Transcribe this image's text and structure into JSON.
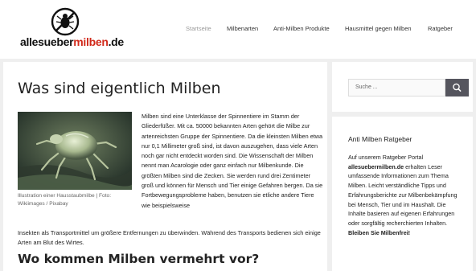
{
  "header": {
    "logo": {
      "part1": "alles",
      "part2": "ueber",
      "part3": "milben",
      "part4": ".de"
    },
    "nav": [
      {
        "label": "Startseite",
        "active": true
      },
      {
        "label": "Milbenarten",
        "active": false
      },
      {
        "label": "Anti-Milben Produkte",
        "active": false
      },
      {
        "label": "Hausmittel gegen Milben",
        "active": false
      },
      {
        "label": "Ratgeber",
        "active": false
      }
    ]
  },
  "article": {
    "title": "Was sind eigentlich Milben",
    "image_caption": "Illustration einer Hausstaubmilbe | Foto: Wikiimages / Pixabay",
    "paragraph_wrapped": "Milben sind eine Unterklasse der Spinnentiere im Stamm der Gliederfüßer. Mit ca. 50000 bekannten Arten gehört die Milbe zur artenreichsten Gruppe der Spinnentiere. Da die kleinsten Milben etwa nur 0,1 Millimeter groß sind, ist davon auszugehen, dass viele Arten noch gar nicht entdeckt worden sind. Die Wissenschaft der Milben nennt man Acarologie oder ganz einfach nur Milbenkunde. Die größten Milben sind die Zecken. Sie werden rund drei Zentimeter groß und können für Mensch und Tier einige Gefahren bergen. Da sie Fortbewegungsprobleme haben, benutzen sie etliche andere Tiere wie beispielsweise",
    "paragraph_full": "Insekten als Transportmittel um größere Entfernungen zu überwinden. Während des Transports bedienen sich einige Arten am Blut des Wirtes.",
    "subheading": "Wo kommen Milben vermehrt vor?"
  },
  "sidebar": {
    "search": {
      "placeholder": "Suche ..."
    },
    "ratgeber": {
      "title": "Anti Milben Ratgeber",
      "intro": "Auf unserem Ratgeber Portal ",
      "site": "allesuebermilben.de",
      "body": " erhalten Leser umfassende Informationen zum Thema Milben. Leicht verständliche Tipps und Erfahrungsberichte zur Milbenbekämpfung bei Mensch, Tier und im Haushalt. Die Inhalte basieren auf eigenen Erfahrungen oder sorgfältig recherchierten Inhalten. ",
      "closing": "Bleiben Sie Milbenfrei!"
    }
  },
  "colors": {
    "brand_red": "#d12a1b",
    "nav_active": "#999999",
    "search_button": "#55555e",
    "page_bg": "#efefef"
  }
}
